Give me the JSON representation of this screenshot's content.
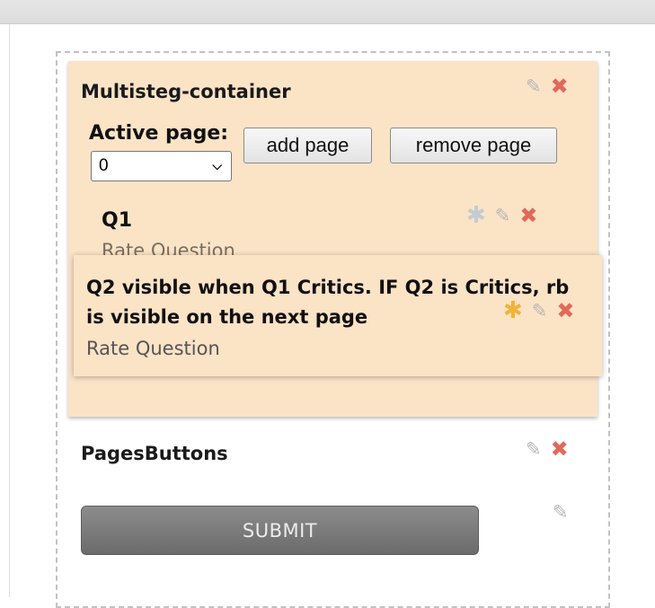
{
  "container": {
    "title": "Multisteg-container",
    "active_page_label": "Active page:",
    "active_page_value": "0",
    "add_page_label": "add page",
    "remove_page_label": "remove page"
  },
  "questions": [
    {
      "title": "Q1",
      "type": "Rate Question"
    },
    {
      "title": "Q2 visible when Q1 Critics. IF Q2 is Critics, rb is visible on the next page",
      "type": "Rate Question"
    }
  ],
  "pages_buttons": {
    "title": "PagesButtons",
    "submit_label": "SUBMIT"
  },
  "icons": {
    "edit": "pencil-icon",
    "delete": "close-icon",
    "required": "star-icon"
  },
  "colors": {
    "panel_bg": "#fbe3c6",
    "delete": "#e06a5a",
    "star_active": "#f1b339",
    "star_inactive": "#c4cbd4",
    "submit_bg": "#7a7a7a"
  }
}
